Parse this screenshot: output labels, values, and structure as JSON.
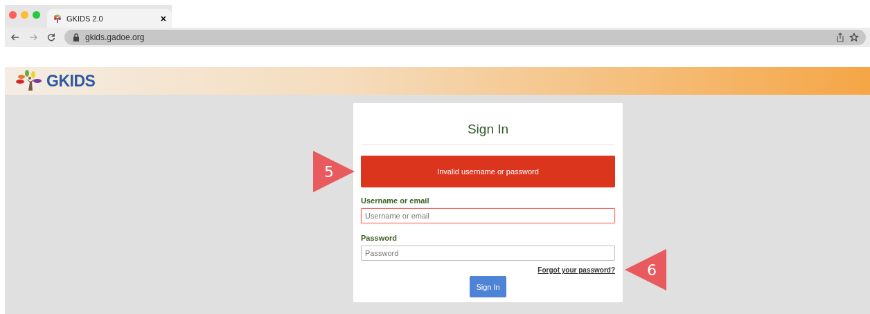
{
  "browser": {
    "tab": {
      "title": "GKIDS 2.0",
      "close": "×"
    },
    "url": "gkids.gadoe.org"
  },
  "header": {
    "logo": "GKIDS"
  },
  "signin": {
    "title": "Sign In",
    "error": "Invalid username or password",
    "fields": [
      {
        "label": "Username or email",
        "placeholder": "Username or email",
        "invalid": true
      },
      {
        "label": "Password",
        "placeholder": "Password",
        "invalid": false
      }
    ],
    "forgot_link": "Forgot your password?",
    "button": "Sign In"
  },
  "callouts": [
    {
      "number": "5",
      "kind": "right"
    },
    {
      "number": "6",
      "kind": "left"
    }
  ]
}
